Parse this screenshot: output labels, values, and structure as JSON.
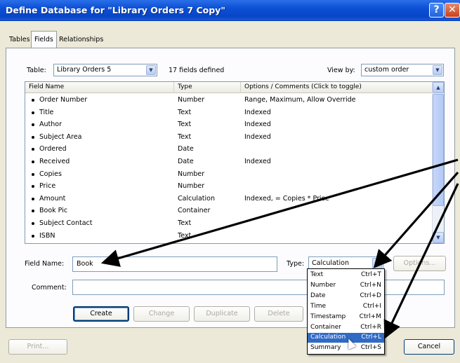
{
  "window": {
    "title": "Define Database for \"Library Orders 7 Copy\"",
    "help_label": "?",
    "close_label": "✕"
  },
  "tabs": [
    {
      "label": "Tables",
      "active": false
    },
    {
      "label": "Fields",
      "active": true
    },
    {
      "label": "Relationships",
      "active": false
    }
  ],
  "table_selector": {
    "label": "Table:",
    "value": "Library Orders 5",
    "count_text": "17 fields defined"
  },
  "view_by": {
    "label": "View by:",
    "value": "custom order"
  },
  "field_list": {
    "columns": [
      "Field Name",
      "Type",
      "Options / Comments   (Click to toggle)"
    ],
    "rows": [
      {
        "name": "Order Number",
        "type": "Number",
        "options": "Range, Maximum, Allow Override"
      },
      {
        "name": "Title",
        "type": "Text",
        "options": "Indexed"
      },
      {
        "name": "Author",
        "type": "Text",
        "options": "Indexed"
      },
      {
        "name": "Subject Area",
        "type": "Text",
        "options": "Indexed"
      },
      {
        "name": "Ordered",
        "type": "Date",
        "options": ""
      },
      {
        "name": "Received",
        "type": "Date",
        "options": "Indexed"
      },
      {
        "name": "Copies",
        "type": "Number",
        "options": ""
      },
      {
        "name": "Price",
        "type": "Number",
        "options": ""
      },
      {
        "name": "Amount",
        "type": "Calculation",
        "options": "Indexed, = Copies * Price"
      },
      {
        "name": "Book Pic",
        "type": "Container",
        "options": ""
      },
      {
        "name": "Subject Contact",
        "type": "Text",
        "options": ""
      },
      {
        "name": "ISBN",
        "type": "Text",
        "options": ""
      }
    ]
  },
  "field_name": {
    "label": "Field Name:",
    "value": "Book"
  },
  "type_select": {
    "label": "Type:",
    "value": "Calculation"
  },
  "options_button": "Options...",
  "comment": {
    "label": "Comment:",
    "value": ""
  },
  "buttons": {
    "create": "Create",
    "change": "Change",
    "duplicate": "Duplicate",
    "delete": "Delete",
    "print": "Print...",
    "cancel": "Cancel"
  },
  "type_dropdown": [
    {
      "name": "Text",
      "shortcut": "Ctrl+T",
      "selected": false
    },
    {
      "name": "Number",
      "shortcut": "Ctrl+N",
      "selected": false
    },
    {
      "name": "Date",
      "shortcut": "Ctrl+D",
      "selected": false
    },
    {
      "name": "Time",
      "shortcut": "Ctrl+I",
      "selected": false
    },
    {
      "name": "Timestamp",
      "shortcut": "Ctrl+M",
      "selected": false
    },
    {
      "name": "Container",
      "shortcut": "Ctrl+R",
      "selected": false
    },
    {
      "name": "Calculation",
      "shortcut": "Ctrl+L",
      "selected": true
    },
    {
      "name": "Summary",
      "shortcut": "Ctrl+S",
      "selected": false
    }
  ],
  "colors": {
    "title_bar": "#0846c8",
    "selection": "#316ac5",
    "annotation_arrows": "#000000"
  }
}
